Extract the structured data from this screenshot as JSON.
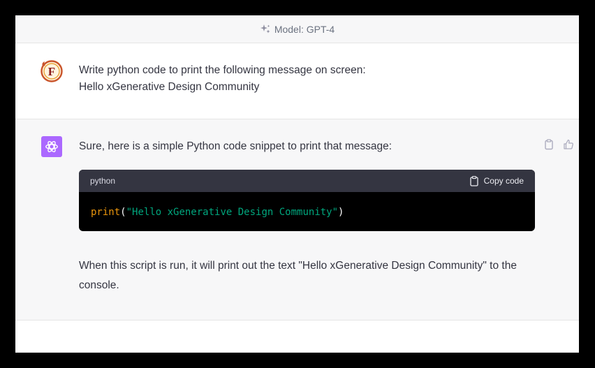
{
  "model_bar": {
    "label": "Model: GPT-4",
    "icon": "sparkle-icon"
  },
  "user_message": {
    "avatar_letter": "F",
    "lines": [
      "Write python code to print the following message on screen:",
      "Hello xGenerative Design Community"
    ]
  },
  "assistant_message": {
    "intro": "Sure, here is a simple Python code snippet to print that message:",
    "code_block": {
      "language": "python",
      "copy_label": "Copy code",
      "tokens": {
        "fn": "print",
        "open": "(",
        "string": "\"Hello xGenerative Design Community\"",
        "close": ")"
      }
    },
    "outro": "When this script is run, it will print out the text \"Hello xGenerative Design Community\" to the console."
  },
  "colors": {
    "accent_gpt": "#ab68ff",
    "code_fn": "#e9950c",
    "code_string": "#00a67d"
  }
}
